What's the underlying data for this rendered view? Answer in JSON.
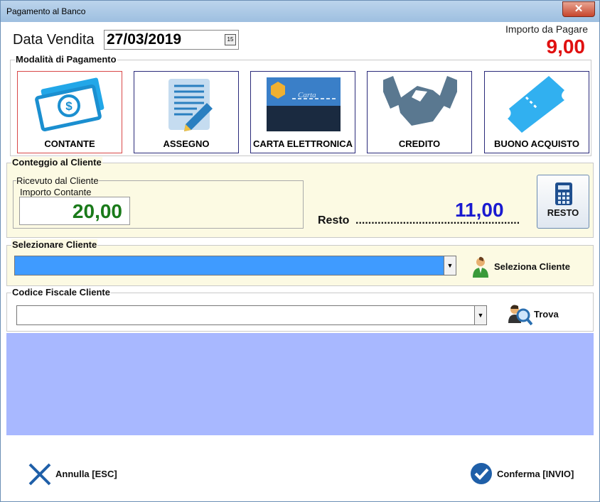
{
  "window": {
    "title": "Pagamento al Banco",
    "close_glyph": "✕"
  },
  "header": {
    "data_label": "Data Vendita",
    "date_value": "27/03/2019",
    "calendar_glyph": "15",
    "importo_label": "Importo da Pagare",
    "importo_value": "9,00"
  },
  "payment": {
    "title": "Modalità di Pagamento",
    "methods": [
      {
        "label": "CONTANTE",
        "icon": "cash-icon",
        "selected": true
      },
      {
        "label": "ASSEGNO",
        "icon": "cheque-icon",
        "selected": false
      },
      {
        "label": "CARTA ELETTRONICA",
        "icon": "credit-card-icon",
        "selected": false
      },
      {
        "label": "CREDITO",
        "icon": "handshake-icon",
        "selected": false
      },
      {
        "label": "BUONO ACQUISTO",
        "icon": "voucher-icon",
        "selected": false
      }
    ]
  },
  "conteggio": {
    "title": "Conteggio al Cliente",
    "ricevuto_title": "Ricevuto dal Cliente",
    "importo_contante_label": "Importo Contante",
    "importo_contante_value": "20,00",
    "resto_label": "Resto",
    "resto_dots": "..........................................................",
    "resto_value": "11,00",
    "resto_button": "RESTO"
  },
  "selezione": {
    "title": "Selezionare Cliente",
    "value": "",
    "button_label": "Seleziona Cliente"
  },
  "codice_fiscale": {
    "title": "Codice Fiscale Cliente",
    "value": "",
    "button_label": "Trova"
  },
  "footer": {
    "annulla_label": "Annulla [ESC]",
    "conferma_label": "Conferma [INVIO]"
  },
  "colors": {
    "importo": "#e01010",
    "contante": "#1a7a1a",
    "resto": "#1a1ad0",
    "highlight_combo": "#3f9bff",
    "blue_area": "#a8b8ff"
  }
}
